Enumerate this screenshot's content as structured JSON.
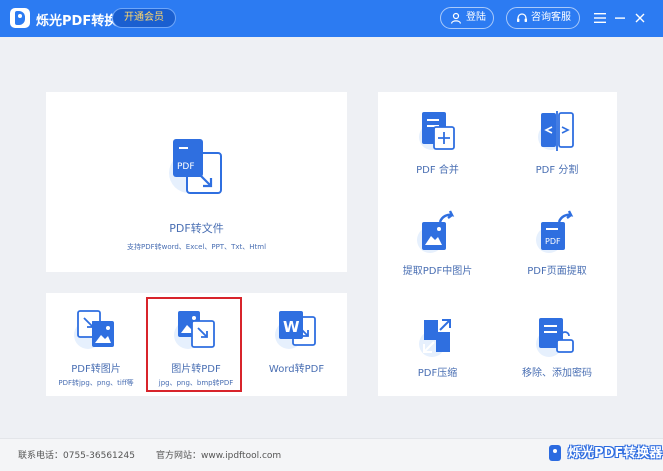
{
  "titlebar": {
    "app_title": "烁光PDF转换器",
    "vip_label": "开通会员",
    "login_label": "登陆",
    "service_label": "咨询客服",
    "menu_icon": "hamburger-icon",
    "minimize_icon": "minimize-icon",
    "close_icon": "close-icon"
  },
  "features": {
    "pdf_to_file": {
      "label": "PDF转文件",
      "sub": "支持PDF转word、Excel、PPT、Txt、Html"
    },
    "pdf_to_image": {
      "label": "PDF转图片",
      "sub": "PDF转jpg、png、tiff等"
    },
    "image_to_pdf": {
      "label": "图片转PDF",
      "sub": "jpg、png、bmp转PDF"
    },
    "word_to_pdf": {
      "label": "Word转PDF"
    },
    "pdf_merge": {
      "label": "PDF 合并"
    },
    "pdf_split": {
      "label": "PDF 分割"
    },
    "extract_images": {
      "label": "提取PDF中图片"
    },
    "extract_pages": {
      "label": "PDF页面提取"
    },
    "pdf_compress": {
      "label": "PDF压缩"
    },
    "remove_password": {
      "label": "移除、添加密码"
    }
  },
  "footer": {
    "phone": "联系电话：0755-36561245",
    "website": "官方网站：www.ipdftool.com",
    "watermark": "烁光PDF转换器"
  },
  "colors": {
    "primary": "#2c7bf2",
    "icon_dark": "#2f6fe0",
    "icon_light": "#e6f0fd",
    "label_blue": "#4a6fb3",
    "highlight_red": "#d8242b"
  }
}
